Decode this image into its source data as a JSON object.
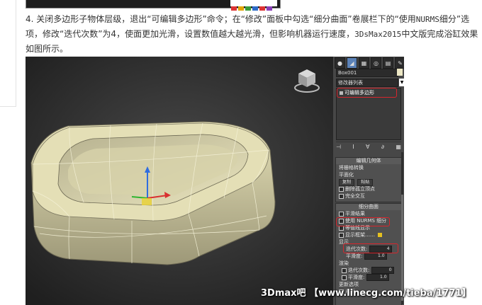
{
  "article": {
    "text_part1": "4. 关闭多边形子物体层级，退出“可编辑多边形”命令；在“修改”面板中勾选“细分曲面”卷展栏下的“使用",
    "text_nurms1": "NURMS",
    "text_part2": "细分”选项，修改“迭代次数”为4，使面更加光滑，设置数值越大越光滑，但影响机器运行速度，",
    "text_brand": "3DsMax2015",
    "text_part3": "中文版完成浴缸效果如图所示。"
  },
  "panel": {
    "tabs": [
      "●",
      "◢",
      "▦",
      "◎",
      "▤",
      "✎"
    ],
    "object_name": "Box001",
    "modifier_list_label": "修改器列表",
    "stack_item": "可编辑多边形",
    "stack_tools": [
      "⊣",
      "I",
      "∀",
      "∂",
      "▦"
    ],
    "selection_rollup": {
      "title": "编辑几何体",
      "row1": "将栅格转换",
      "row2": "平面化",
      "btn_copy": "复制",
      "btn_paste": "粘贴",
      "row_delete": "删除孤立顶点",
      "row_full": "完全交互"
    },
    "subdiv_rollup": {
      "title": "细分曲面",
      "row_smooth": "平滑结果",
      "row_nurms": "使用 NURMS 细分",
      "row_cage": "等值线显示",
      "row_show": "显示框架……",
      "section_display": "显示",
      "iter_label": "迭代次数:",
      "iter_value": "4",
      "smooth_label": "平滑度:",
      "smooth_value": "1.0",
      "section_render": "渲染",
      "iter2_label": "迭代次数:",
      "iter2_value": "0",
      "smooth2_label": "平滑度:",
      "smooth2_value": "1.0",
      "section_update": "更新选项",
      "row_never": "从不"
    }
  },
  "watermark": "3Dmax吧 【www.linecg.com/tieba/1771】",
  "colors": {
    "accent_red": "#d8262d",
    "viewport_bg": "#303030",
    "panel_bg": "#474747",
    "tub": "#d8d3a8"
  }
}
